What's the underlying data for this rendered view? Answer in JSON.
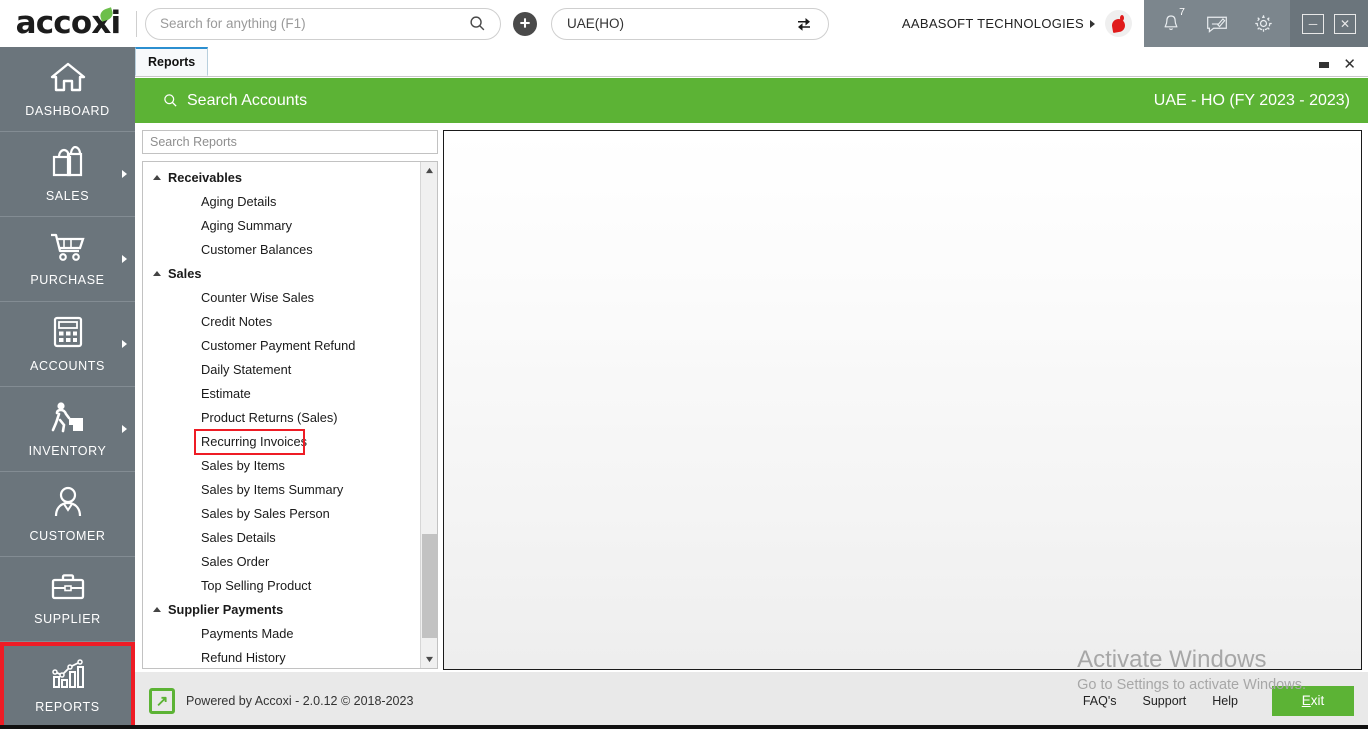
{
  "app": {
    "logo_text": "accoxi",
    "footer_note": "Powered by Accoxi - 2.0.12 © 2018-2023"
  },
  "topbar": {
    "search_placeholder": "Search for anything (F1)",
    "search_value": "",
    "search_icon": "search-icon",
    "add_icon": "plus-icon",
    "branch_value": "UAE(HO)",
    "branch_switch_icon": "swap-icon",
    "org_name": "AABASOFT TECHNOLOGIES",
    "avatar_icon": "user-avatar",
    "notification_icon": "bell-icon",
    "notification_count": "7",
    "message_icon": "message-icon",
    "settings_icon": "gear-icon",
    "minimize_label": "─",
    "close_label": "✕"
  },
  "sidebar": {
    "items": [
      {
        "label": "DASHBOARD",
        "icon": "home-icon",
        "has_arrow": false,
        "highlighted": false
      },
      {
        "label": "SALES",
        "icon": "shopping-bag-icon",
        "has_arrow": true,
        "highlighted": false
      },
      {
        "label": "PURCHASE",
        "icon": "cart-icon",
        "has_arrow": true,
        "highlighted": false
      },
      {
        "label": "ACCOUNTS",
        "icon": "calculator-icon",
        "has_arrow": true,
        "highlighted": false
      },
      {
        "label": "INVENTORY",
        "icon": "warehouse-worker-icon",
        "has_arrow": true,
        "highlighted": false
      },
      {
        "label": "CUSTOMER",
        "icon": "person-icon",
        "has_arrow": false,
        "highlighted": false
      },
      {
        "label": "SUPPLIER",
        "icon": "briefcase-icon",
        "has_arrow": false,
        "highlighted": false
      },
      {
        "label": "REPORTS",
        "icon": "bar-chart-icon",
        "has_arrow": false,
        "highlighted": true
      }
    ],
    "highlight_color": "#ee1c25"
  },
  "tabbar": {
    "tabs": [
      {
        "label": "Reports",
        "active": true
      }
    ],
    "dropdown_icon": "chevron-down-icon",
    "close_icon": "close-icon"
  },
  "greenbar": {
    "title": "Search Accounts",
    "search_icon": "search-icon",
    "context": "UAE - HO (FY 2023 - 2023)",
    "color": "#5cb335"
  },
  "reports_panel": {
    "search_placeholder": "Search Reports",
    "search_value": "",
    "groups": [
      {
        "label": "Receivables",
        "expanded": true,
        "items": [
          {
            "label": "Aging Details",
            "marked": false
          },
          {
            "label": "Aging Summary",
            "marked": false
          },
          {
            "label": "Customer Balances",
            "marked": false
          }
        ]
      },
      {
        "label": "Sales",
        "expanded": true,
        "items": [
          {
            "label": "Counter Wise Sales",
            "marked": false
          },
          {
            "label": "Credit Notes",
            "marked": false
          },
          {
            "label": "Customer Payment Refund",
            "marked": false
          },
          {
            "label": "Daily Statement",
            "marked": false
          },
          {
            "label": "Estimate",
            "marked": false
          },
          {
            "label": "Product Returns (Sales)",
            "marked": false
          },
          {
            "label": "Recurring Invoices",
            "marked": true
          },
          {
            "label": "Sales by Items",
            "marked": false
          },
          {
            "label": "Sales by Items Summary",
            "marked": false
          },
          {
            "label": "Sales by Sales Person",
            "marked": false
          },
          {
            "label": "Sales Details",
            "marked": false
          },
          {
            "label": "Sales Order",
            "marked": false
          },
          {
            "label": "Top Selling Product",
            "marked": false
          }
        ]
      },
      {
        "label": "Supplier Payments",
        "expanded": true,
        "items": [
          {
            "label": "Payments Made",
            "marked": false
          },
          {
            "label": "Refund History",
            "marked": false
          }
        ]
      }
    ],
    "scroll_up_icon": "scroll-up-arrow",
    "scroll_down_icon": "scroll-down-arrow"
  },
  "footer": {
    "logo_icon": "accoxi-arrow-logo",
    "links": [
      "FAQ's",
      "Support",
      "Help"
    ],
    "exit_label": "Exit",
    "exit_accel": "E",
    "exit_rest": "xit"
  },
  "watermark": {
    "title": "Activate Windows",
    "subtitle": "Go to Settings to activate Windows."
  }
}
